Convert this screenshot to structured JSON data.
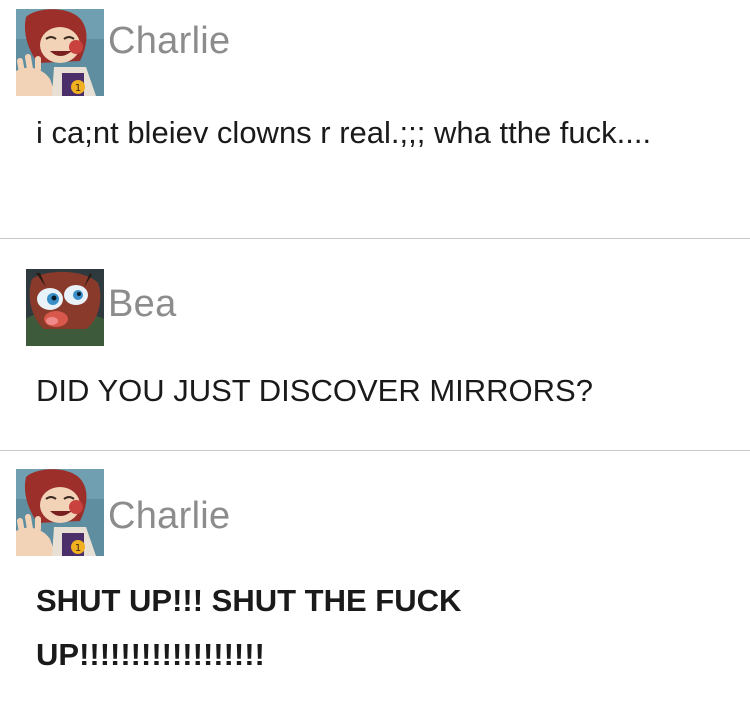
{
  "posts": [
    {
      "username": "Charlie",
      "avatar_icon": "avatar-charlie-icon",
      "text": "i ca;nt bleiev clowns r real.;;; wha tthe fuck....",
      "bold": false
    },
    {
      "username": "Bea",
      "avatar_icon": "avatar-bea-icon",
      "text": "DID YOU JUST DISCOVER MIRRORS?",
      "bold": false
    },
    {
      "username": "Charlie",
      "avatar_icon": "avatar-charlie-icon",
      "text": "SHUT UP!!! SHUT THE FUCK UP!!!!!!!!!!!!!!!!!!",
      "bold": true
    }
  ],
  "colors": {
    "username": "#8c8c8c",
    "divider": "#c9c9c9",
    "text": "#1a1a1a"
  }
}
